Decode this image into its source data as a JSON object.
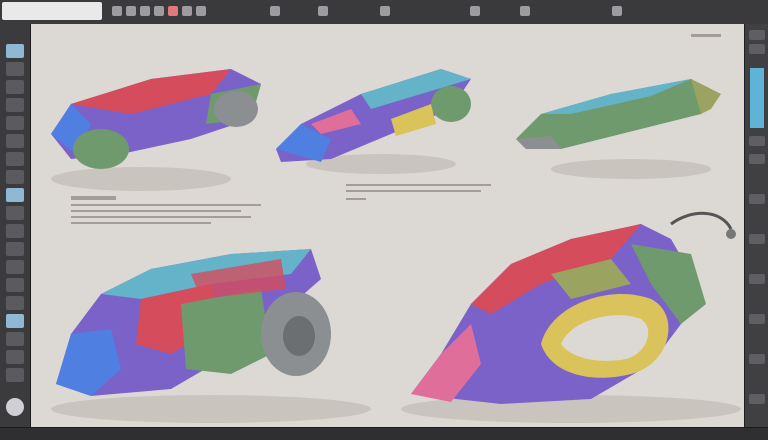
{
  "topbar": {
    "icons": [
      "tab-icon",
      "folder-icon",
      "save-icon",
      "brush-icon",
      "pen-icon",
      "eraser-icon",
      "zoom-icon",
      "hand-icon",
      "layers-icon",
      "settings-icon",
      "grid-icon",
      "eye-icon",
      "link-icon",
      "info-icon"
    ]
  },
  "left_toolbar": {
    "tools": [
      "move-icon",
      "select-icon",
      "lasso-icon",
      "brush-icon",
      "pencil-icon",
      "eraser-icon",
      "fill-icon",
      "gradient-icon",
      "text-icon",
      "shape-icon",
      "eyedropper-icon",
      "zoom-icon",
      "hand-icon",
      "rotate-icon",
      "crop-icon",
      "transform-icon",
      "smudge-icon",
      "blur-icon",
      "clone-icon",
      "color-icon"
    ]
  },
  "canvas": {
    "sketches": [
      "concept-vehicle-1",
      "concept-vehicle-2",
      "concept-vehicle-3",
      "concept-vehicle-4",
      "concept-vehicle-5"
    ],
    "colors": {
      "paper": "#dcd9d4",
      "shadow": "#c9c4bd",
      "red": "#d54c5d",
      "purple": "#7b62c9",
      "blue": "#4f7fe0",
      "teal": "#64b3c9",
      "green": "#6f9a6e",
      "olive": "#9aa35f",
      "gray": "#8b8f92",
      "pink": "#e06e9a",
      "yellow": "#d9c35a"
    }
  },
  "right_strip": {
    "items": [
      "panel-1",
      "panel-2",
      "panel-3",
      "panel-4",
      "panel-5",
      "panel-6",
      "panel-7",
      "panel-8",
      "panel-9",
      "panel-10",
      "panel-11"
    ]
  }
}
